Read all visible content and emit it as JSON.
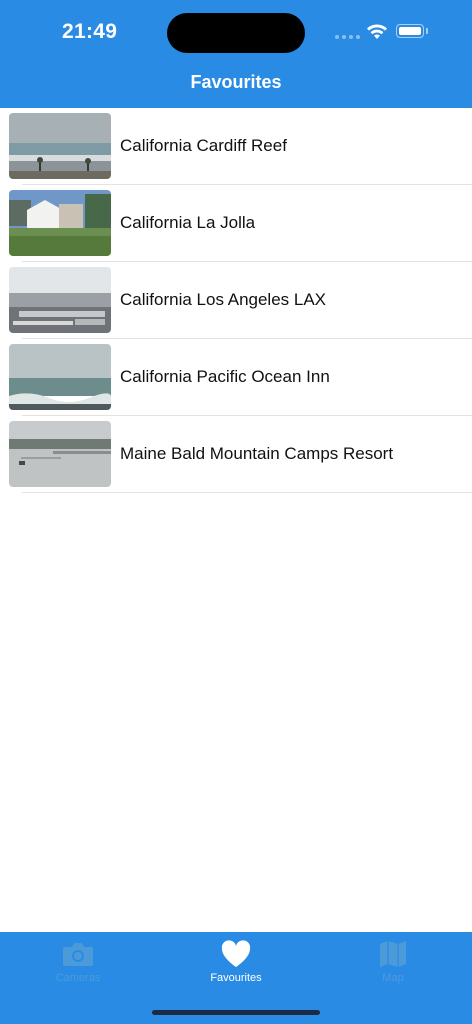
{
  "status_bar": {
    "time": "21:49"
  },
  "nav": {
    "title": "Favourites"
  },
  "favourites": [
    {
      "name": "California Cardiff Reef"
    },
    {
      "name": "California La Jolla"
    },
    {
      "name": "California Los Angeles LAX"
    },
    {
      "name": "California Pacific Ocean Inn"
    },
    {
      "name": "Maine Bald Mountain Camps Resort"
    }
  ],
  "tabs": [
    {
      "label": "Cameras",
      "icon": "camera-icon",
      "selected": false
    },
    {
      "label": "Favourites",
      "icon": "heart-icon",
      "selected": true
    },
    {
      "label": "Map",
      "icon": "map-icon",
      "selected": false
    }
  ],
  "colors": {
    "accent": "#2a8be4",
    "inactive_tab": "#4d9ad9"
  }
}
